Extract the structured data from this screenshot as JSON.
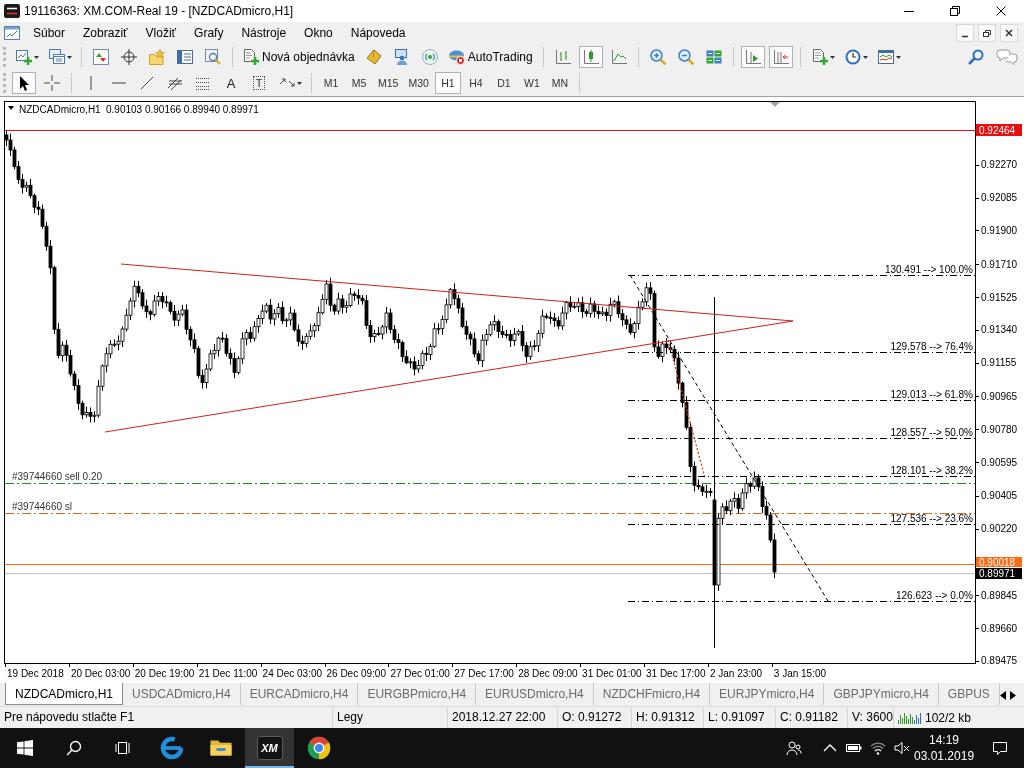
{
  "window": {
    "title": "19116363: XM.COM-Real 19 - [NZDCADmicro,H1]"
  },
  "menu": [
    "Súbor",
    "Zobraziť",
    "Vložiť",
    "Grafy",
    "Nástroje",
    "Okno",
    "Nápoveda"
  ],
  "toolbar": {
    "new_order": "Nová objednávka",
    "autotrading": "AutoTrading",
    "chart_types": [
      {
        "kind": "bars",
        "selected": false
      },
      {
        "kind": "candles",
        "selected": true
      },
      {
        "kind": "line",
        "selected": false
      }
    ],
    "view_toggles": [
      {
        "kind": "autoscroll",
        "on": true
      },
      {
        "kind": "chart-shift",
        "on": true
      }
    ]
  },
  "drawing_toolbar": {
    "tools": [
      {
        "kind": "cursor",
        "selected": true
      },
      {
        "kind": "crosshair",
        "selected": false
      },
      {
        "kind": "vertical-line",
        "selected": false
      },
      {
        "kind": "horizontal-line",
        "selected": false
      },
      {
        "kind": "trendline",
        "selected": false
      },
      {
        "kind": "fibo-fan",
        "selected": false
      },
      {
        "kind": "fibo-levels",
        "selected": false
      },
      {
        "kind": "text",
        "label": "A",
        "selected": false
      },
      {
        "kind": "text-label",
        "label": "T",
        "selected": false
      },
      {
        "kind": "arrows",
        "selected": false
      }
    ],
    "timeframes": [
      {
        "label": "M1",
        "selected": false
      },
      {
        "label": "M5",
        "selected": false
      },
      {
        "label": "M15",
        "selected": false
      },
      {
        "label": "M30",
        "selected": false
      },
      {
        "label": "H1",
        "selected": true
      },
      {
        "label": "H4",
        "selected": false
      },
      {
        "label": "D1",
        "selected": false
      },
      {
        "label": "W1",
        "selected": false
      },
      {
        "label": "MN",
        "selected": false
      }
    ]
  },
  "chart": {
    "symbol": "NZDCADmicro,H1",
    "ohlc": "0.90103 0.90166 0.89940 0.89971",
    "price_ticks": [
      "0.92270",
      "0.92085",
      "0.91900",
      "0.91710",
      "0.91525",
      "0.91340",
      "0.91155",
      "0.90965",
      "0.90780",
      "0.90595",
      "0.90405",
      "0.90220",
      "0.89845",
      "0.89660",
      "0.89475"
    ],
    "time_labels": [
      "19 Dec 2018",
      "20 Dec 03:00",
      "20 Dec 19:00",
      "21 Dec 11:00",
      "24 Dec 03:00",
      "26 Dec 09:00",
      "27 Dec 01:00",
      "27 Dec 17:00",
      "28 Dec 09:00",
      "31 Dec 01:00",
      "31 Dec 17:00",
      "2 Jan 23:00",
      "3 Jan 15:00"
    ],
    "price_tags": [
      {
        "kind": "line",
        "price": "0.92464",
        "color": "#e81010"
      },
      {
        "kind": "ask",
        "price": "0.90018",
        "color": "#ff6a13"
      },
      {
        "kind": "bid",
        "price": "0.89971",
        "color": "#000000"
      }
    ],
    "orders": [
      {
        "label": "#39744660 sell 0.20",
        "color": "#1f8a1f"
      },
      {
        "label": "#39744660 sl",
        "color": "#d2691e"
      }
    ],
    "fibonacci": [
      "130.491 --> 100.0%",
      "129.578 --> 76.4%",
      "129.013 --> 61.8%",
      "128.557 --> 50.0%",
      "128.101 --> 38.2%",
      "127.536 --> 23.6%",
      "126.623 --> 0.0%"
    ]
  },
  "tabs": [
    {
      "label": "NZDCADmicro,H1",
      "selected": true
    },
    {
      "label": "USDCADmicro,H4",
      "selected": false
    },
    {
      "label": "EURCADmicro,H4",
      "selected": false
    },
    {
      "label": "EURGBPmicro,H4",
      "selected": false
    },
    {
      "label": "EURUSDmicro,H4",
      "selected": false
    },
    {
      "label": "NZDCHFmicro,H4",
      "selected": false
    },
    {
      "label": "EURJPYmicro,H4",
      "selected": false
    },
    {
      "label": "GBPJPYmicro,H4",
      "selected": false
    },
    {
      "label": "GBPUS",
      "selected": false
    }
  ],
  "status_bar": {
    "help": "Pre nápovedu stlačte F1",
    "profile": "Legy",
    "time": "2018.12.27 22:00",
    "open": "O: 0.91272",
    "high": "H: 0.91312",
    "low": "L: 0.91097",
    "close": "C: 0.91182",
    "volume": "V: 3600",
    "traffic": "102/2 kb"
  },
  "taskbar": {
    "apps": [
      {
        "kind": "edge",
        "selected": false
      },
      {
        "kind": "explorer",
        "selected": false
      },
      {
        "kind": "xm",
        "label": "XM",
        "selected": true
      },
      {
        "kind": "chrome",
        "selected": false
      }
    ],
    "time": "14:19",
    "date": "03.01.2019"
  }
}
